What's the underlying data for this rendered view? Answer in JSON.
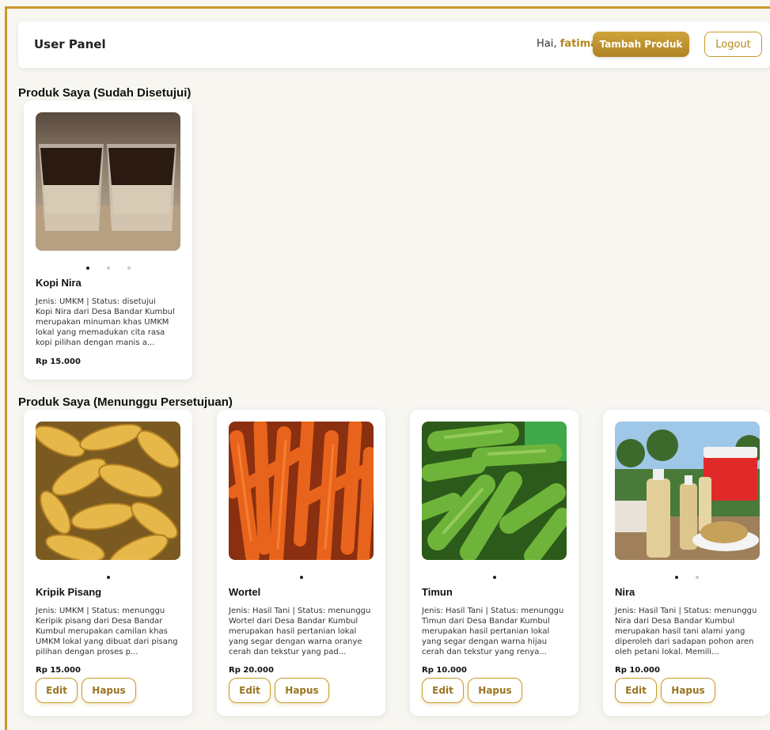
{
  "header": {
    "brand": "User Panel",
    "greeting": "Hai,",
    "username": "fatimah",
    "add_label": "Tambah Produk",
    "logout_label": "Logout"
  },
  "approved": {
    "title": "Produk Saya (Sudah Disetujui)",
    "products": [
      {
        "name": "Kopi Nira",
        "meta": "Jenis: UMKM | Status: disetujui",
        "desc": "Kopi Nira dari Desa Bandar Kumbul merupakan minuman khas UMKM lokal yang memadukan cita rasa kopi pilihan dengan manis a...",
        "price": "Rp 15.000",
        "image": "coffee-glasses"
      }
    ]
  },
  "pending": {
    "title": "Produk Saya (Menunggu Persetujuan)",
    "edit_label": "Edit",
    "delete_label": "Hapus",
    "products": [
      {
        "name": "Kripik Pisang",
        "meta": "Jenis: UMKM | Status: menunggu",
        "desc": "Keripik pisang dari Desa Bandar Kumbul merupakan camilan khas UMKM lokal yang dibuat dari pisang pilihan dengan proses p...",
        "price": "Rp 15.000",
        "image": "banana-chips"
      },
      {
        "name": "Wortel",
        "meta": "Jenis: Hasil Tani | Status: menunggu",
        "desc": "Wortel dari Desa Bandar Kumbul merupakan hasil pertanian lokal yang segar dengan warna oranye cerah dan tekstur yang pad...",
        "price": "Rp 20.000",
        "image": "carrots"
      },
      {
        "name": "Timun",
        "meta": "Jenis: Hasil Tani | Status: menunggu",
        "desc": "Timun dari Desa Bandar Kumbul merupakan hasil pertanian lokal yang segar dengan warna hijau cerah dan tekstur yang renya...",
        "price": "Rp 10.000",
        "image": "cucumbers"
      },
      {
        "name": "Nira",
        "meta": "Jenis: Hasil Tani | Status: menunggu",
        "desc": "Nira dari Desa Bandar Kumbul merupakan hasil tani alami yang diperoleh dari sadapan pohon aren oleh petani lokal. Memili...",
        "price": "Rp 10.000",
        "image": "nira-bottles"
      }
    ]
  },
  "colors": {
    "accent": "#c89a28",
    "background": "#f8f6f1"
  }
}
